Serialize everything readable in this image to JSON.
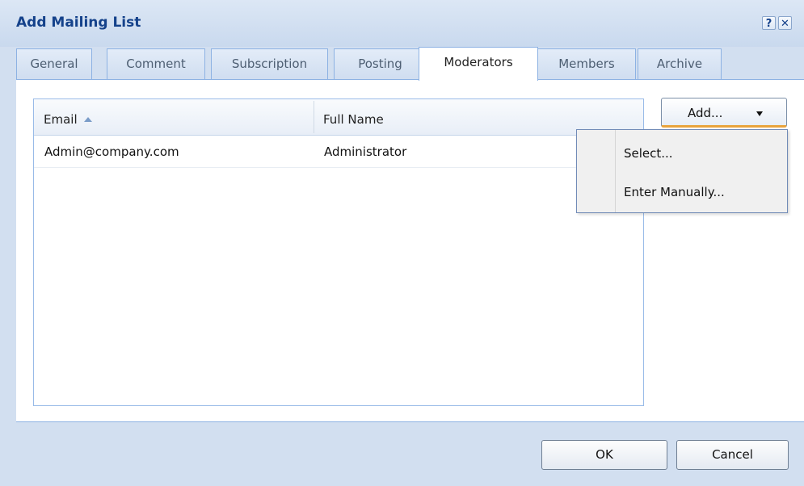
{
  "window": {
    "title": "Add Mailing List"
  },
  "title_buttons": {
    "help": "?",
    "close": "✕"
  },
  "tabs": [
    {
      "label": "General"
    },
    {
      "label": "Comment"
    },
    {
      "label": "Subscription"
    },
    {
      "label": "Posting"
    },
    {
      "label": "Moderators",
      "active": true
    },
    {
      "label": "Members"
    },
    {
      "label": "Archive"
    }
  ],
  "grid": {
    "columns": [
      {
        "label": "Email",
        "sort": "ascending"
      },
      {
        "label": "Full Name"
      }
    ],
    "rows": [
      {
        "email": "Admin@company.com",
        "full_name": "Administrator"
      }
    ]
  },
  "add_button": {
    "label": "Add..."
  },
  "add_menu": {
    "items": [
      {
        "label": "Select..."
      },
      {
        "label": "Enter Manually..."
      }
    ]
  },
  "footer": {
    "ok_label": "OK",
    "cancel_label": "Cancel"
  },
  "colors": {
    "accent": "#15428b",
    "tab_border": "#8db2e3",
    "button_highlight": "#e8a33c"
  }
}
